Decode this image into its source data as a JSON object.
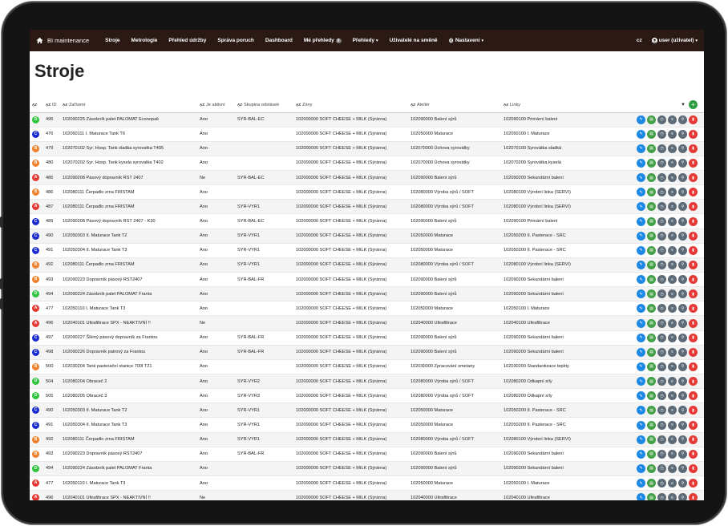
{
  "navbar": {
    "brand": "BI maintenance",
    "items": [
      {
        "label": "Stroje"
      },
      {
        "label": "Metrologie"
      },
      {
        "label": "Přehled údržby"
      },
      {
        "label": "Správa poruch"
      },
      {
        "label": "Dashboard"
      },
      {
        "label": "Mé přehledy",
        "badge": "0"
      },
      {
        "label": "Přehledy",
        "dropdown": true
      },
      {
        "label": "Uživatelé na směně"
      },
      {
        "label": "Nastavení",
        "dropdown": true,
        "icon": "gear-icon"
      }
    ],
    "lang": "cz",
    "user": "user (uživatel)"
  },
  "page_title": "Stroje",
  "table": {
    "columns": [
      "ID",
      "Zařízení",
      "Je aktivní",
      "Skupina odstávek",
      "Zóny",
      "Ateliér",
      "Linky"
    ],
    "level_colors": {
      "A": "#e53935",
      "B": "#f0802a",
      "C": "#1a2ccf",
      "D": "#2ec43c"
    },
    "rows": [
      {
        "lvl": "D",
        "id": "495",
        "device": "102090225 Zásobník palet PALOMAT Econopak",
        "active": "Ano",
        "group": "SYR-BAL-EC",
        "zone": "102000000 SOFT CHEESE + MILK (Sýrárna)",
        "atelier": "102090000 Balení sýrů",
        "line": "102090100 Primární balení"
      },
      {
        "lvl": "C",
        "id": "476",
        "device": "102050111 I. Maturace Tank T6",
        "active": "Ano",
        "group": "",
        "zone": "102000000 SOFT CHEESE + MILK (Sýrárna)",
        "atelier": "102050000 Maturace",
        "line": "102050100 I. Maturace"
      },
      {
        "lvl": "B",
        "id": "479",
        "device": "102070102 Syr. Hosp. Tank sladka syrovatka T405",
        "active": "Ano",
        "group": "",
        "zone": "102000000 SOFT CHEESE + MILK (Sýrárna)",
        "atelier": "102070000 Úchova syrovátky",
        "line": "102070100 Syrovátka sladká"
      },
      {
        "lvl": "B",
        "id": "480",
        "device": "102070202 Syr. Hosp. Tank kysela syrovatka T402",
        "active": "Ano",
        "group": "",
        "zone": "102000000 SOFT CHEESE + MILK (Sýrárna)",
        "atelier": "102070000 Úchova syrovátky",
        "line": "102070200 Syrovátka kyselá"
      },
      {
        "lvl": "A",
        "id": "485",
        "device": "102090208 Pásový dopravník RST 2407",
        "active": "Ne",
        "group": "SYR-BAL-EC",
        "zone": "102000000 SOFT CHEESE + MILK (Sýrárna)",
        "atelier": "102090000 Balení sýrů",
        "line": "102090200 Sekundární balení"
      },
      {
        "lvl": "B",
        "id": "486",
        "device": "102080111 Čerpadlo zrna FRISTAM",
        "active": "Ano",
        "group": "",
        "zone": "102000000 SOFT CHEESE + MILK (Sýrárna)",
        "atelier": "102080000 Výroba sýrů / SOFT",
        "line": "102080100 Výrobní linka (SERVI)"
      },
      {
        "lvl": "A",
        "id": "487",
        "device": "102080111 Čerpadlo zrna FRISTAM",
        "active": "Ano",
        "group": "SYR-VYR1",
        "zone": "102000000 SOFT CHEESE + MILK (Sýrárna)",
        "atelier": "102080000 Výroba sýrů / SOFT",
        "line": "102080100 Výrobní linka (SERVI)"
      },
      {
        "lvl": "C",
        "id": "489",
        "device": "102090208 Pásový dopravník RST 2407 - K30",
        "active": "Ano",
        "group": "SYR-BAL-EC",
        "zone": "102000000 SOFT CHEESE + MILK (Sýrárna)",
        "atelier": "102090000 Balení sýrů",
        "line": "102090100 Primární balení"
      },
      {
        "lvl": "C",
        "id": "490",
        "device": "102050303 II. Maturace Tank T2",
        "active": "Ano",
        "group": "SYR-VYR1",
        "zone": "102000000 SOFT CHEESE + MILK (Sýrárna)",
        "atelier": "102050000 Maturace",
        "line": "102050200 II. Pasterace - SRC"
      },
      {
        "lvl": "C",
        "id": "491",
        "device": "102050304 II. Maturace Tank T3",
        "active": "Ano",
        "group": "SYR-VYR1",
        "zone": "102000000 SOFT CHEESE + MILK (Sýrárna)",
        "atelier": "102050000 Maturace",
        "line": "102050200 II. Pasterace - SRC"
      },
      {
        "lvl": "B",
        "id": "492",
        "device": "102080111 Čerpadlo zrna FRISTAM",
        "active": "Ano",
        "group": "SYR-VYR1",
        "zone": "102000000 SOFT CHEESE + MILK (Sýrárna)",
        "atelier": "102080000 Výroba sýrů / SOFT",
        "line": "102080100 Výrobní linka (SERVI)"
      },
      {
        "lvl": "B",
        "id": "493",
        "device": "102090223 Dopravník pásový RST2407",
        "active": "Ano",
        "group": "SYR-BAL-FR",
        "zone": "102000000 SOFT CHEESE + MILK (Sýrárna)",
        "atelier": "102090000 Balení sýrů",
        "line": "102090200 Sekundární balení"
      },
      {
        "lvl": "D",
        "id": "494",
        "device": "102090224 Zásobník palet PALOMAT Franta",
        "active": "Ano",
        "group": "",
        "zone": "102000000 SOFT CHEESE + MILK (Sýrárna)",
        "atelier": "102090000 Balení sýrů",
        "line": "102090200 Sekundární balení"
      },
      {
        "lvl": "A",
        "id": "477",
        "device": "102050110 I. Maturace Tank T3",
        "active": "Ano",
        "group": "",
        "zone": "102000000 SOFT CHEESE + MILK (Sýrárna)",
        "atelier": "102050000 Maturace",
        "line": "102050100 I. Maturace"
      },
      {
        "lvl": "A",
        "id": "496",
        "device": "102040101 Ultrafiltrace SPX - NEAKTIVNÍ !!",
        "active": "Ne",
        "group": "",
        "zone": "102000000 SOFT CHEESE + MILK (Sýrárna)",
        "atelier": "102040000 Ultrafiltrace",
        "line": "102040100 Ultrafiltrace"
      },
      {
        "lvl": "C",
        "id": "497",
        "device": "102090227 Šikmý pásový dopravník za Frantou",
        "active": "Ano",
        "group": "SYR-BAL-FR",
        "zone": "102000000 SOFT CHEESE + MILK (Sýrárna)",
        "atelier": "102090000 Balení sýrů",
        "line": "102090200 Sekundární balení"
      },
      {
        "lvl": "C",
        "id": "498",
        "device": "102090226 Dopravník patrový za Frantou",
        "active": "Ano",
        "group": "SYR-BAL-FR",
        "zone": "102000000 SOFT CHEESE + MILK (Sýrárna)",
        "atelier": "102090000 Balení sýrů",
        "line": "102090200 Sekundární balení"
      },
      {
        "lvl": "B",
        "id": "500",
        "device": "102030204 Tank pasterační stanice 700l T21",
        "active": "Ano",
        "group": "",
        "zone": "102000000 SOFT CHEESE + MILK (Sýrárna)",
        "atelier": "102030000 Zpracování smetany",
        "line": "102030200 Standardizace tepkty"
      },
      {
        "lvl": "D",
        "id": "504",
        "device": "102080204 Obraceč 2",
        "active": "Ano",
        "group": "SYR-VYR2",
        "zone": "102000000 SOFT CHEESE + MILK (Sýrárna)",
        "atelier": "102080000 Výroba sýrů / SOFT",
        "line": "102080200 Odkapní síly"
      },
      {
        "lvl": "D",
        "id": "505",
        "device": "102080205 Obraceč 3",
        "active": "Ano",
        "group": "SYR-VYR3",
        "zone": "102000000 SOFT CHEESE + MILK (Sýrárna)",
        "atelier": "102080000 Výroba sýrů / SOFT",
        "line": "102080200 Odkapní síly"
      },
      {
        "lvl": "C",
        "id": "490",
        "device": "102050303 II. Maturace Tank T2",
        "active": "Ano",
        "group": "SYR-VYR1",
        "zone": "102000000 SOFT CHEESE + MILK (Sýrárna)",
        "atelier": "102050000 Maturace",
        "line": "102050200 II. Pasterace - SRC"
      },
      {
        "lvl": "C",
        "id": "491",
        "device": "102050304 II. Maturace Tank T3",
        "active": "Ano",
        "group": "SYR-VYR1",
        "zone": "102000000 SOFT CHEESE + MILK (Sýrárna)",
        "atelier": "102050000 Maturace",
        "line": "102050200 II. Pasterace - SRC"
      },
      {
        "lvl": "B",
        "id": "492",
        "device": "102080111 Čerpadlo zrna FRISTAM",
        "active": "Ano",
        "group": "SYR-VYR1",
        "zone": "102000000 SOFT CHEESE + MILK (Sýrárna)",
        "atelier": "102080000 Výroba sýrů / SOFT",
        "line": "102080100 Výrobní linka (SERVI)"
      },
      {
        "lvl": "B",
        "id": "493",
        "device": "102090223 Dopravník pásový RST2407",
        "active": "Ano",
        "group": "SYR-BAL-FR",
        "zone": "102000000 SOFT CHEESE + MILK (Sýrárna)",
        "atelier": "102090000 Balení sýrů",
        "line": "102090200 Sekundární balení"
      },
      {
        "lvl": "D",
        "id": "494",
        "device": "102090224 Zásobník palet PALOMAT Franta",
        "active": "Ano",
        "group": "",
        "zone": "102000000 SOFT CHEESE + MILK (Sýrárna)",
        "atelier": "102090000 Balení sýrů",
        "line": "102090200 Sekundární balení"
      },
      {
        "lvl": "A",
        "id": "477",
        "device": "102050110 I. Maturace Tank T3",
        "active": "Ano",
        "group": "",
        "zone": "102000000 SOFT CHEESE + MILK (Sýrárna)",
        "atelier": "102050000 Maturace",
        "line": "102050100 I. Maturace"
      },
      {
        "lvl": "A",
        "id": "496",
        "device": "102040101 Ultrafiltrace SPX - NEAKTIVNÍ !!",
        "active": "Ne",
        "group": "",
        "zone": "102000000 SOFT CHEESE + MILK (Sýrárna)",
        "atelier": "102040000 Ultrafiltrace",
        "line": "102040100 Ultrafiltrace"
      }
    ],
    "row_actions": [
      "edit-icon",
      "document-icon",
      "clock-icon",
      "list-icon",
      "pin-icon",
      "trash-icon"
    ]
  }
}
